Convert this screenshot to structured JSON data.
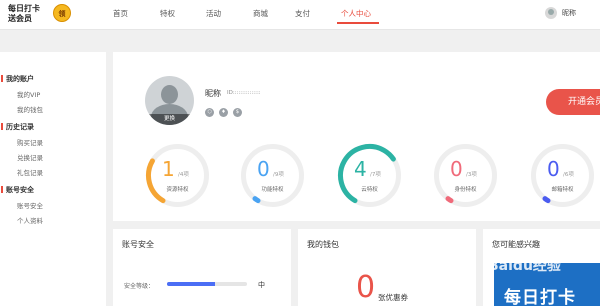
{
  "logo": {
    "line1": "每日打卡",
    "line2": "送会员",
    "badge": "领"
  },
  "nav": {
    "items": [
      "首页",
      "特权",
      "活动",
      "商城",
      "支付",
      "个人中心"
    ],
    "active_index": 5
  },
  "user": {
    "name": "昵称"
  },
  "sidebar": {
    "sections": [
      {
        "title": "我的账户",
        "items": [
          "我的VIP",
          "我的钱包"
        ]
      },
      {
        "title": "历史记录",
        "items": [
          "购买记录",
          "兑换记录",
          "礼包记录"
        ]
      },
      {
        "title": "账号安全",
        "items": [
          "账号安全",
          "个人资料"
        ]
      }
    ]
  },
  "profile": {
    "avatar_change": "更换",
    "nickname": "昵称",
    "uid_label": "ID:::::::::::::::",
    "open_button": "开通会员"
  },
  "stats": [
    {
      "value": "1",
      "total": "/4项",
      "label": "资源特权",
      "color": "#f5a534",
      "fraction": 0.25
    },
    {
      "value": "0",
      "total": "/9项",
      "label": "功能特权",
      "color": "#4aa3f2",
      "fraction": 0.0
    },
    {
      "value": "4",
      "total": "/7项",
      "label": "云特权",
      "color": "#2cb3a4",
      "fraction": 0.57
    },
    {
      "value": "0",
      "total": "/3项",
      "label": "身份特权",
      "color": "#f06a7a",
      "fraction": 0.0
    },
    {
      "value": "0",
      "total": "/6项",
      "label": "邮箱特权",
      "color": "#4b5cf0",
      "fraction": 0.0
    }
  ],
  "account_security": {
    "title": "账号安全",
    "level_label": "安全等级：",
    "level_value": "中",
    "level_fraction": 0.6,
    "accent": "#4b6ef5"
  },
  "wallet": {
    "title": "我的钱包",
    "coupon_count": "0",
    "coupon_label": "张优惠券"
  },
  "interest": {
    "title": "您可能感兴趣",
    "promo": "每日打卡"
  },
  "watermark": "Baidu经验"
}
